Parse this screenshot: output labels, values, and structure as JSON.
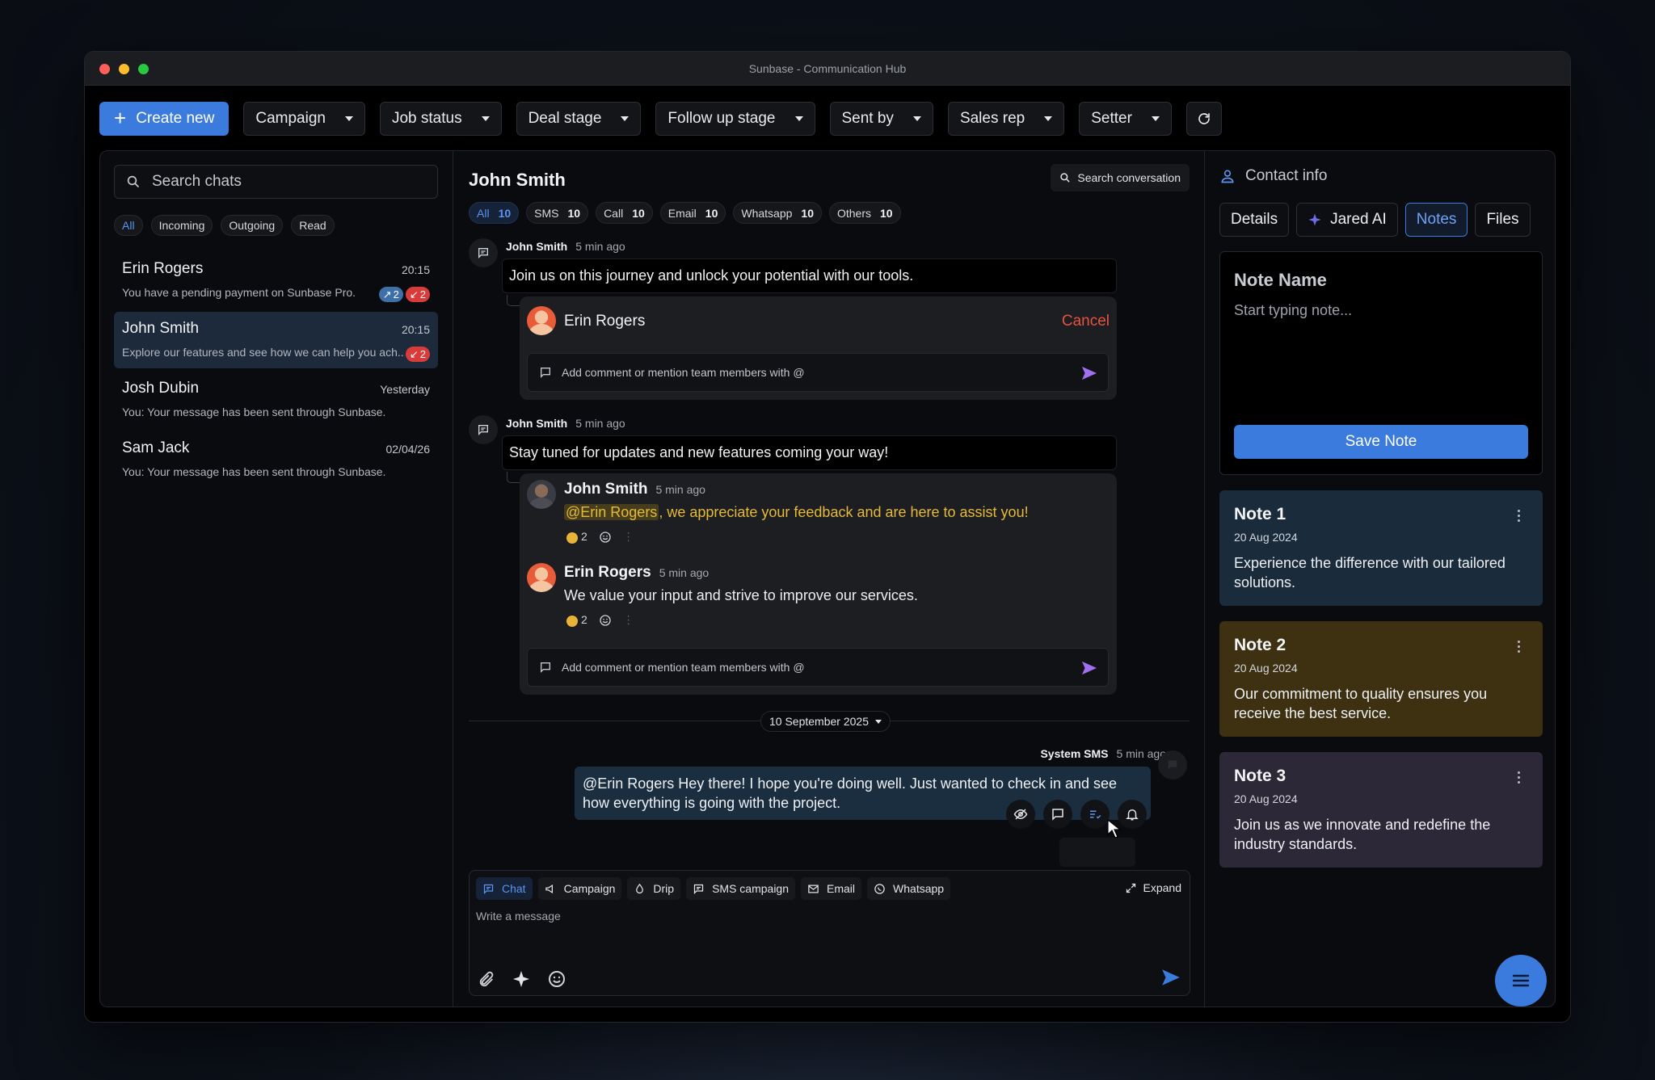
{
  "window": {
    "title": "Sunbase - Communication Hub"
  },
  "colors": {
    "accent": "#3b7bdd",
    "danger": "#e5533e",
    "note1": "#1a2c3c",
    "note2": "#3d3112",
    "note3": "#2d2838"
  },
  "toolbar": {
    "create_label": "Create new",
    "filters": [
      "Campaign",
      "Job status",
      "Deal stage",
      "Follow up stage",
      "Sent by",
      "Sales rep",
      "Setter"
    ]
  },
  "sidebar": {
    "search_placeholder": "Search chats",
    "filters": [
      "All",
      "Incoming",
      "Outgoing",
      "Read"
    ],
    "chats": [
      {
        "name": "Erin Rogers",
        "time": "20:15",
        "preview": "You have a pending payment on Sunbase Pro.",
        "badge_blue": "2",
        "badge_red": "2"
      },
      {
        "name": "John Smith",
        "time": "20:15",
        "preview": "Explore our features and see how we can help you ach...",
        "badge_red": "2"
      },
      {
        "name": "Josh Dubin",
        "time": "Yesterday",
        "preview": "You: Your message has been sent through Sunbase."
      },
      {
        "name": "Sam Jack",
        "time": "02/04/26",
        "preview": "You: Your message has been sent through Sunbase."
      }
    ]
  },
  "conversation": {
    "title": "John Smith",
    "search_label": "Search conversation",
    "tabs": [
      {
        "label": "All",
        "count": "10"
      },
      {
        "label": "SMS",
        "count": "10"
      },
      {
        "label": "Call",
        "count": "10"
      },
      {
        "label": "Email",
        "count": "10"
      },
      {
        "label": "Whatsapp",
        "count": "10"
      },
      {
        "label": "Others",
        "count": "10"
      }
    ],
    "msg1": {
      "author": "John Smith",
      "time": "5 min ago",
      "text": "Join us on this journey and unlock your potential with our tools.",
      "thread_user": "Erin Rogers",
      "cancel": "Cancel",
      "comment_placeholder": "Add comment or mention team members with @"
    },
    "msg2": {
      "author": "John Smith",
      "time": "5 min ago",
      "text": "Stay tuned for updates and new features coming your way!",
      "reply1": {
        "author": "John Smith",
        "time": "5 min ago",
        "mention": "@Erin Rogers",
        "text": ", we appreciate your feedback and are here to assist you!",
        "reactions": "2"
      },
      "reply2": {
        "author": "Erin Rogers",
        "time": "5 min ago",
        "text": "We value your input and strive to improve our services.",
        "reactions": "2"
      },
      "comment_placeholder": "Add comment or mention team members with @"
    },
    "date_divider": "10 September 2025",
    "system": {
      "author": "System SMS",
      "time": "5 min ago",
      "text": "@Erin Rogers Hey there! I hope you're doing well. Just wanted to check in and see how everything is going with the project."
    }
  },
  "composer": {
    "tabs": [
      "Chat",
      "Campaign",
      "Drip",
      "SMS campaign",
      "Email",
      "Whatsapp"
    ],
    "expand": "Expand",
    "placeholder": "Write a message"
  },
  "contact": {
    "header": "Contact info",
    "tabs": [
      "Details",
      "Jared AI",
      "Notes",
      "Files"
    ],
    "note_name_placeholder": "Note Name",
    "note_body_placeholder": "Start typing note...",
    "save_label": "Save Note",
    "notes": [
      {
        "title": "Note 1",
        "date": "20 Aug 2024",
        "body": "Experience the difference with our tailored solutions."
      },
      {
        "title": "Note 2",
        "date": "20 Aug 2024",
        "body": "Our commitment to quality ensures you receive the best service."
      },
      {
        "title": "Note 3",
        "date": "20 Aug 2024",
        "body": "Join us as we innovate and redefine the industry standards."
      }
    ]
  }
}
